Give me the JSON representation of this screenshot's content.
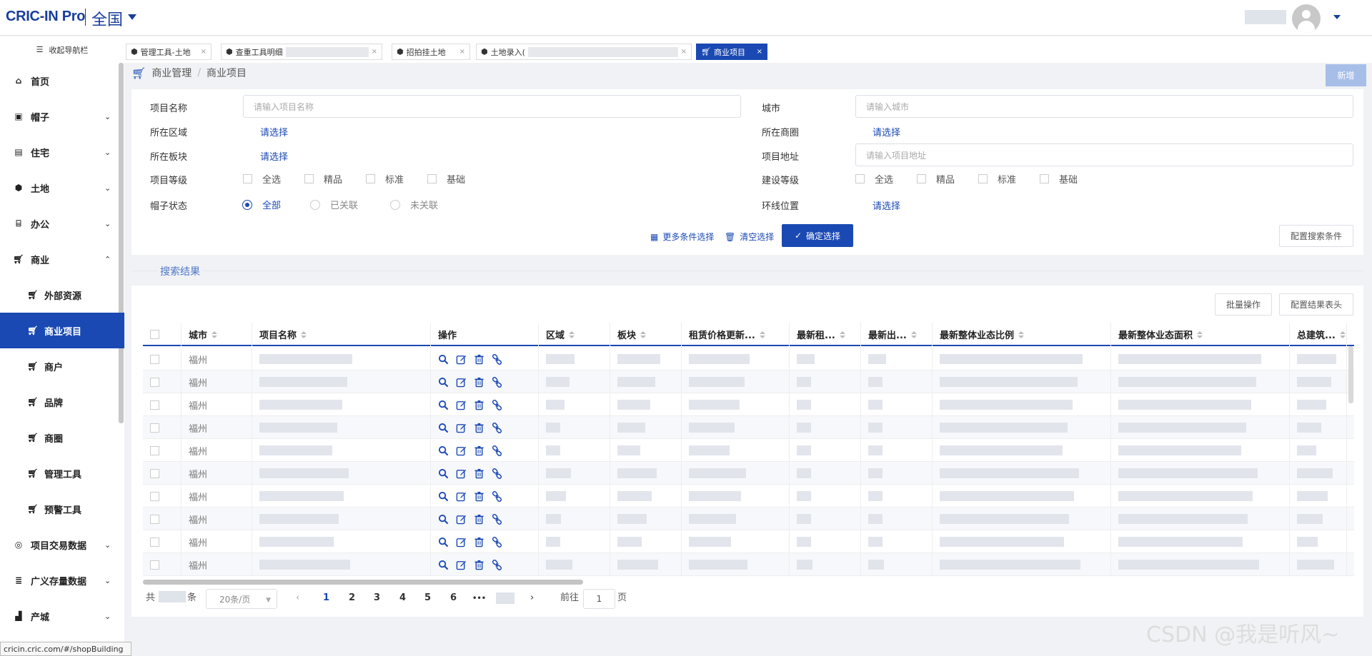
{
  "header": {
    "logo": "CRIC-IN Pro",
    "region": "全国"
  },
  "tabs": {
    "collapse_label": "收起导航栏",
    "items": [
      {
        "label": "管理工具-土地",
        "active": false
      },
      {
        "label": "查重工具明细",
        "active": false
      },
      {
        "label": "招拍挂土地",
        "active": false
      },
      {
        "label": "土地录入(",
        "active": false
      },
      {
        "label": "商业项目",
        "active": true
      }
    ],
    "close_glyph": "×"
  },
  "sidebar": {
    "items": [
      {
        "label": "首页",
        "icon": "home-icon"
      },
      {
        "label": "帽子",
        "icon": "hat-icon",
        "expand": "⌄"
      },
      {
        "label": "住宅",
        "icon": "document-icon",
        "expand": "⌄"
      },
      {
        "label": "土地",
        "icon": "cube-icon",
        "expand": "⌄"
      },
      {
        "label": "办公",
        "icon": "bank-icon",
        "expand": "⌄"
      },
      {
        "label": "商业",
        "icon": "cart-icon",
        "expand": "⌃"
      },
      {
        "label": "外部资源",
        "icon": "cart-icon"
      },
      {
        "label": "商业项目",
        "icon": "cart-icon"
      },
      {
        "label": "商户",
        "icon": "cart-icon"
      },
      {
        "label": "品牌",
        "icon": "cart-icon"
      },
      {
        "label": "商圈",
        "icon": "cart-icon"
      },
      {
        "label": "管理工具",
        "icon": "cart-icon"
      },
      {
        "label": "预警工具",
        "icon": "cart-icon"
      },
      {
        "label": "项目交易数据",
        "icon": "exchange-icon",
        "expand": "⌄"
      },
      {
        "label": "广义存量数据",
        "icon": "database-icon",
        "expand": "⌄"
      },
      {
        "label": "产城",
        "icon": "factory-icon",
        "expand": "⌄"
      }
    ]
  },
  "status_url": "cricin.cric.com/#/shopBuilding",
  "breadcrumb": {
    "root": "商业管理",
    "sep": "/",
    "current": "商业项目"
  },
  "new_button": "新增",
  "filters": {
    "project_name": {
      "label": "项目名称",
      "placeholder": "请输入项目名称"
    },
    "city": {
      "label": "城市",
      "placeholder": "请输入城市"
    },
    "district": {
      "label": "所在区域",
      "value": "请选择"
    },
    "business_circle": {
      "label": "所在商圈",
      "value": "请选择"
    },
    "block": {
      "label": "所在板块",
      "value": "请选择"
    },
    "address": {
      "label": "项目地址",
      "placeholder": "请输入项目地址"
    },
    "project_level": {
      "label": "项目等级",
      "options": [
        "全选",
        "精品",
        "标准",
        "基础"
      ]
    },
    "build_level": {
      "label": "建设等级",
      "options": [
        "全选",
        "精品",
        "标准",
        "基础"
      ]
    },
    "hat_status": {
      "label": "帽子状态",
      "options": [
        "全部",
        "已关联",
        "未关联"
      ],
      "selected": "全部"
    },
    "ring_position": {
      "label": "环线位置",
      "value": "请选择"
    },
    "more_conditions": "更多条件选择",
    "clear": "清空选择",
    "confirm": "确定选择",
    "config_search": "配置搜索条件"
  },
  "results": {
    "title": "搜索结果",
    "batch": "批量操作",
    "config_header": "配置结果表头",
    "columns": [
      "城市",
      "项目名称",
      "操作",
      "区域",
      "板块",
      "租赁价格更新...",
      "最新租...",
      "最新出...",
      "最新整体业态比例",
      "最新整体业态面积",
      "总建筑..."
    ],
    "rows": [
      {
        "city": "福州"
      },
      {
        "city": "福州"
      },
      {
        "city": "福州"
      },
      {
        "city": "福州"
      },
      {
        "city": "福州"
      },
      {
        "city": "福州"
      },
      {
        "city": "福州"
      },
      {
        "city": "福州"
      },
      {
        "city": "福州"
      },
      {
        "city": "福州"
      }
    ]
  },
  "pagination": {
    "total_prefix": "共",
    "total_suffix": "条",
    "page_size": "20条/页",
    "pages": [
      "1",
      "2",
      "3",
      "4",
      "5",
      "6"
    ],
    "ellipsis": "•••",
    "current": "1",
    "goto_label": "前往",
    "goto_value": "1",
    "goto_suffix": "页"
  },
  "watermark": "CSDN @我是听风~",
  "colors": {
    "primary": "#1a49b3",
    "brand": "#1a3e9c",
    "disabled": "#a7bfe8"
  }
}
